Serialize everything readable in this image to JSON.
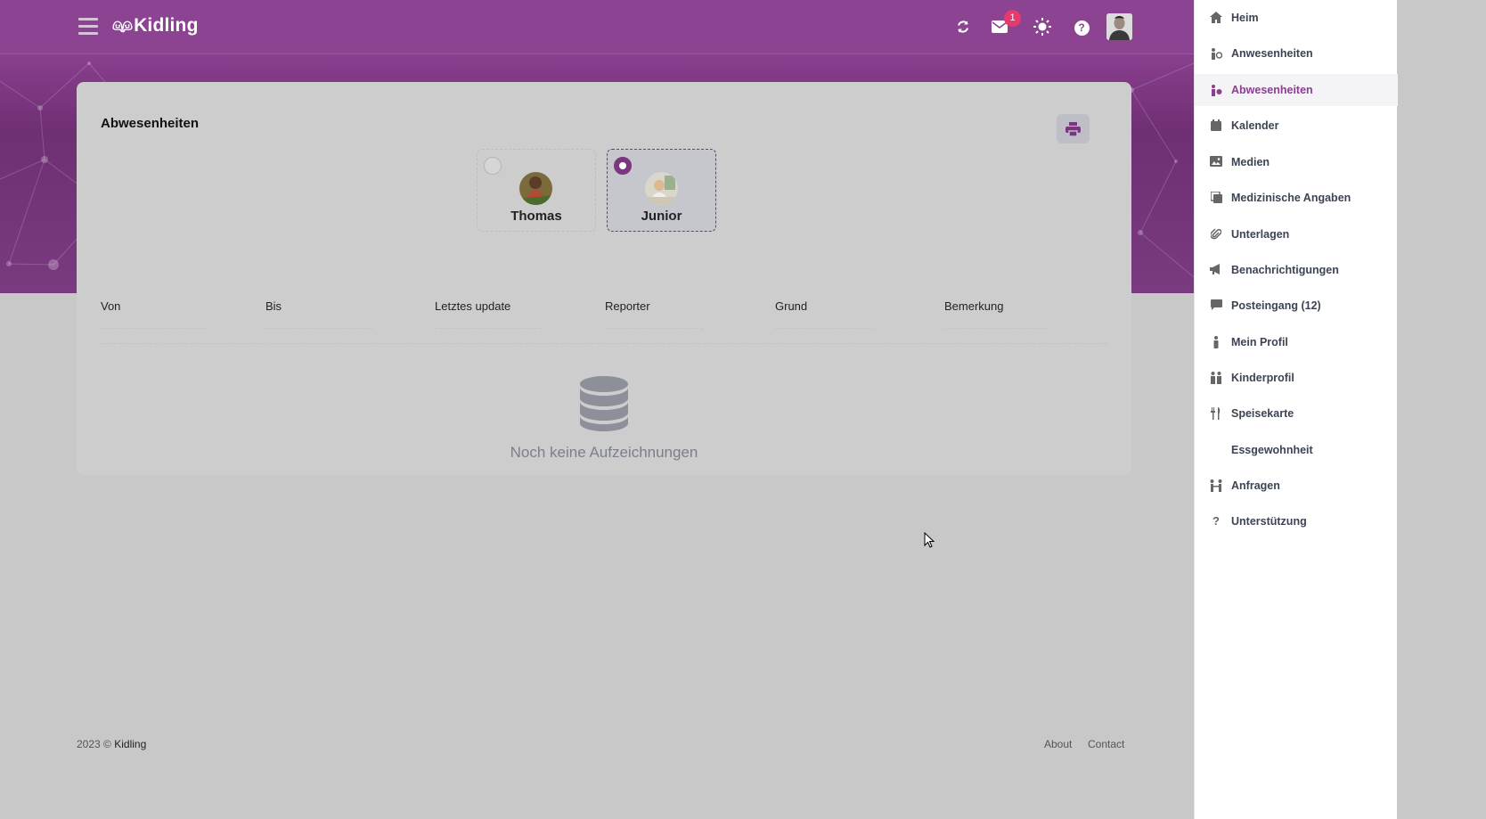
{
  "app": {
    "logo_text": "Kidling",
    "logo_mark": "🚻"
  },
  "header": {
    "icons": [
      "hamburger-icon",
      "refresh-icon",
      "mail-icon",
      "sun-icon",
      "help-icon",
      "user-avatar"
    ],
    "mail_badge": "1",
    "help_glyph": "?"
  },
  "page": {
    "title": "Abwesenheiten",
    "children": [
      {
        "name": "Thomas",
        "selected": false
      },
      {
        "name": "Junior",
        "selected": true
      }
    ],
    "table": {
      "columns": [
        "Von",
        "Bis",
        "Letztes update",
        "Reporter",
        "Grund",
        "Bemerkung"
      ]
    },
    "empty_message": "Noch keine Aufzeichnungen"
  },
  "footer": {
    "copyright": "2023 ©",
    "brand": "Kidling",
    "links": [
      "About",
      "Contact"
    ]
  },
  "sidebar": {
    "items": [
      {
        "label": "Heim",
        "icon": "home-icon"
      },
      {
        "label": "Anwesenheiten",
        "icon": "attendance-icon"
      },
      {
        "label": "Abwesenheiten",
        "icon": "absence-icon",
        "active": true
      },
      {
        "label": "Kalender",
        "icon": "calendar-icon"
      },
      {
        "label": "Medien",
        "icon": "image-icon"
      },
      {
        "label": "Medizinische Angaben",
        "icon": "medical-icon"
      },
      {
        "label": "Unterlagen",
        "icon": "paperclip-icon"
      },
      {
        "label": "Benachrichtigungen",
        "icon": "megaphone-icon"
      },
      {
        "label": "Posteingang (12)",
        "icon": "chat-icon"
      },
      {
        "label": "Mein Profil",
        "icon": "person-icon"
      },
      {
        "label": "Kinderprofil",
        "icon": "children-icon"
      },
      {
        "label": "Speisekarte",
        "icon": "cutlery-icon"
      },
      {
        "label": "Essgewohnheit",
        "icon": ""
      },
      {
        "label": "Anfragen",
        "icon": "requests-icon"
      },
      {
        "label": "Unterstützung",
        "icon": "question-icon"
      }
    ]
  },
  "colors": {
    "brand": "#8b4392",
    "accent": "#7b3680",
    "badge": "#e53a6b",
    "muted": "#7b7f8a"
  }
}
